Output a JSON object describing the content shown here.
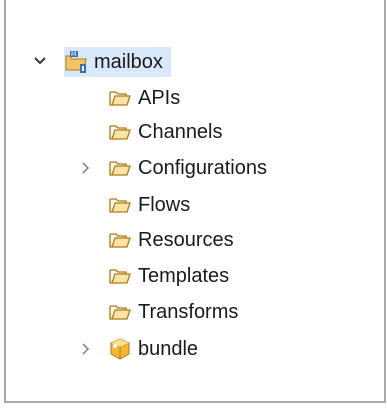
{
  "tree": {
    "root": {
      "label": "mailbox",
      "icon": "project-folder-icon",
      "expanded": true,
      "selected": true
    },
    "children": [
      {
        "label": "APIs",
        "icon": "folder-open-icon",
        "expandable": false
      },
      {
        "label": "Channels",
        "icon": "folder-open-icon",
        "expandable": false
      },
      {
        "label": "Configurations",
        "icon": "folder-open-icon",
        "expandable": true
      },
      {
        "label": "Flows",
        "icon": "folder-open-icon",
        "expandable": false
      },
      {
        "label": "Resources",
        "icon": "folder-open-icon",
        "expandable": false
      },
      {
        "label": "Templates",
        "icon": "folder-open-icon",
        "expandable": false
      },
      {
        "label": "Transforms",
        "icon": "folder-open-icon",
        "expandable": false
      },
      {
        "label": "bundle",
        "icon": "bundle-icon",
        "expandable": true
      }
    ]
  },
  "colors": {
    "selection": "#d9e8fb",
    "folder": "#f2c463",
    "folder_stroke": "#b07a1a",
    "bundle": "#f5b82e",
    "border": "#a8a8a8"
  }
}
